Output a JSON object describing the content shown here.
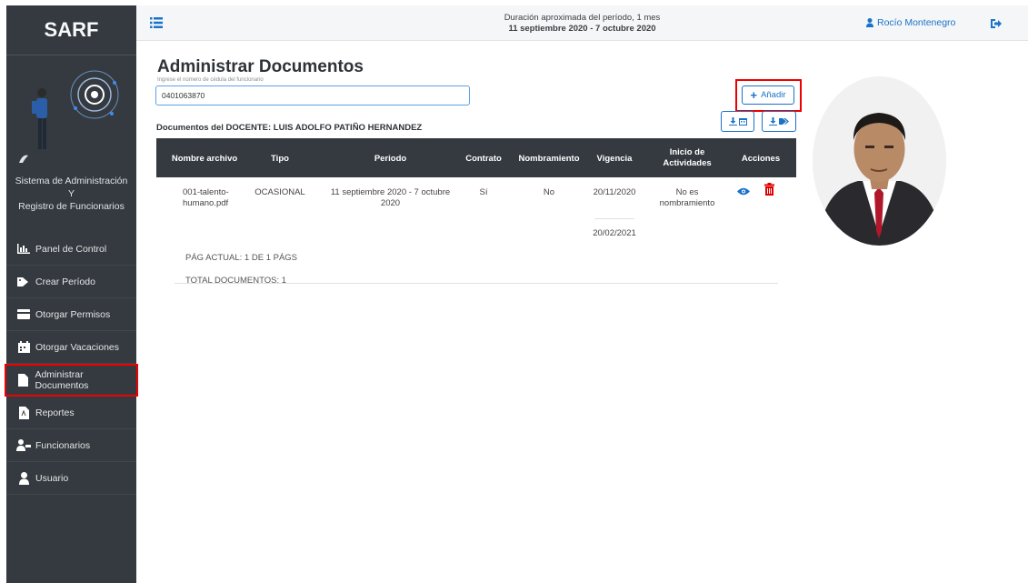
{
  "app": {
    "brand": "SARF"
  },
  "sidebar": {
    "system_name_line1": "Sistema de Administración",
    "system_name_line2": "Y",
    "system_name_line3": "Registro de Funcionarios",
    "items": [
      {
        "label": "Panel de Control",
        "icon": "chart-icon"
      },
      {
        "label": "Crear Período",
        "icon": "tag-icon"
      },
      {
        "label": "Otorgar Permisos",
        "icon": "card-icon"
      },
      {
        "label": "Otorgar Vacaciones",
        "icon": "calendar-icon"
      },
      {
        "label": "Administrar Documentos",
        "icon": "file-icon",
        "active": true
      },
      {
        "label": "Reportes",
        "icon": "pdf-file-icon"
      },
      {
        "label": "Funcionarios",
        "icon": "users-icon"
      },
      {
        "label": "Usuario",
        "icon": "user-icon"
      }
    ]
  },
  "topbar": {
    "period_line1": "Duración aproximada del período, 1 mes",
    "period_line2": "11 septiembre 2020 - 7 octubre 2020",
    "user_name": "Rocío Montenegro"
  },
  "main": {
    "title": "Administrar Documentos",
    "cedula_hint": "Ingrese el número de cédula del funcionario",
    "cedula_value": "0401063870",
    "add_label": "Añadir",
    "docs_title": "Documentos del DOCENTE: LUIS ADOLFO PATIÑO HERNANDEZ",
    "table": {
      "headers": [
        "Nombre archivo",
        "Tipo",
        "Periodo",
        "Contrato",
        "Nombramiento",
        "Vigencia",
        "Inicio de Actividades",
        "Acciones"
      ],
      "header_inicio_line1": "Inicio de",
      "header_inicio_line2": "Actividades",
      "rows": [
        {
          "nombre_line1": "001-talento-",
          "nombre_line2": "humano.pdf",
          "tipo": "OCASIONAL",
          "periodo_line1": "11 septiembre 2020 - 7 octubre",
          "periodo_line2": "2020",
          "contrato": "Sí",
          "nombramiento": "No",
          "vigencia_desde": "20/11/2020",
          "vigencia_hasta": "20/02/2021",
          "inicio_line1": "No es",
          "inicio_line2": "nombramiento"
        }
      ]
    },
    "pagination": "PÁG ACTUAL: 1 DE 1 PÁGS",
    "total": "TOTAL DOCUMENTOS: 1"
  },
  "colors": {
    "sidebar": "#343a40",
    "accent": "#1a73c9",
    "highlight": "#e00000",
    "table_header": "#343a40",
    "delete": "#e00000"
  }
}
